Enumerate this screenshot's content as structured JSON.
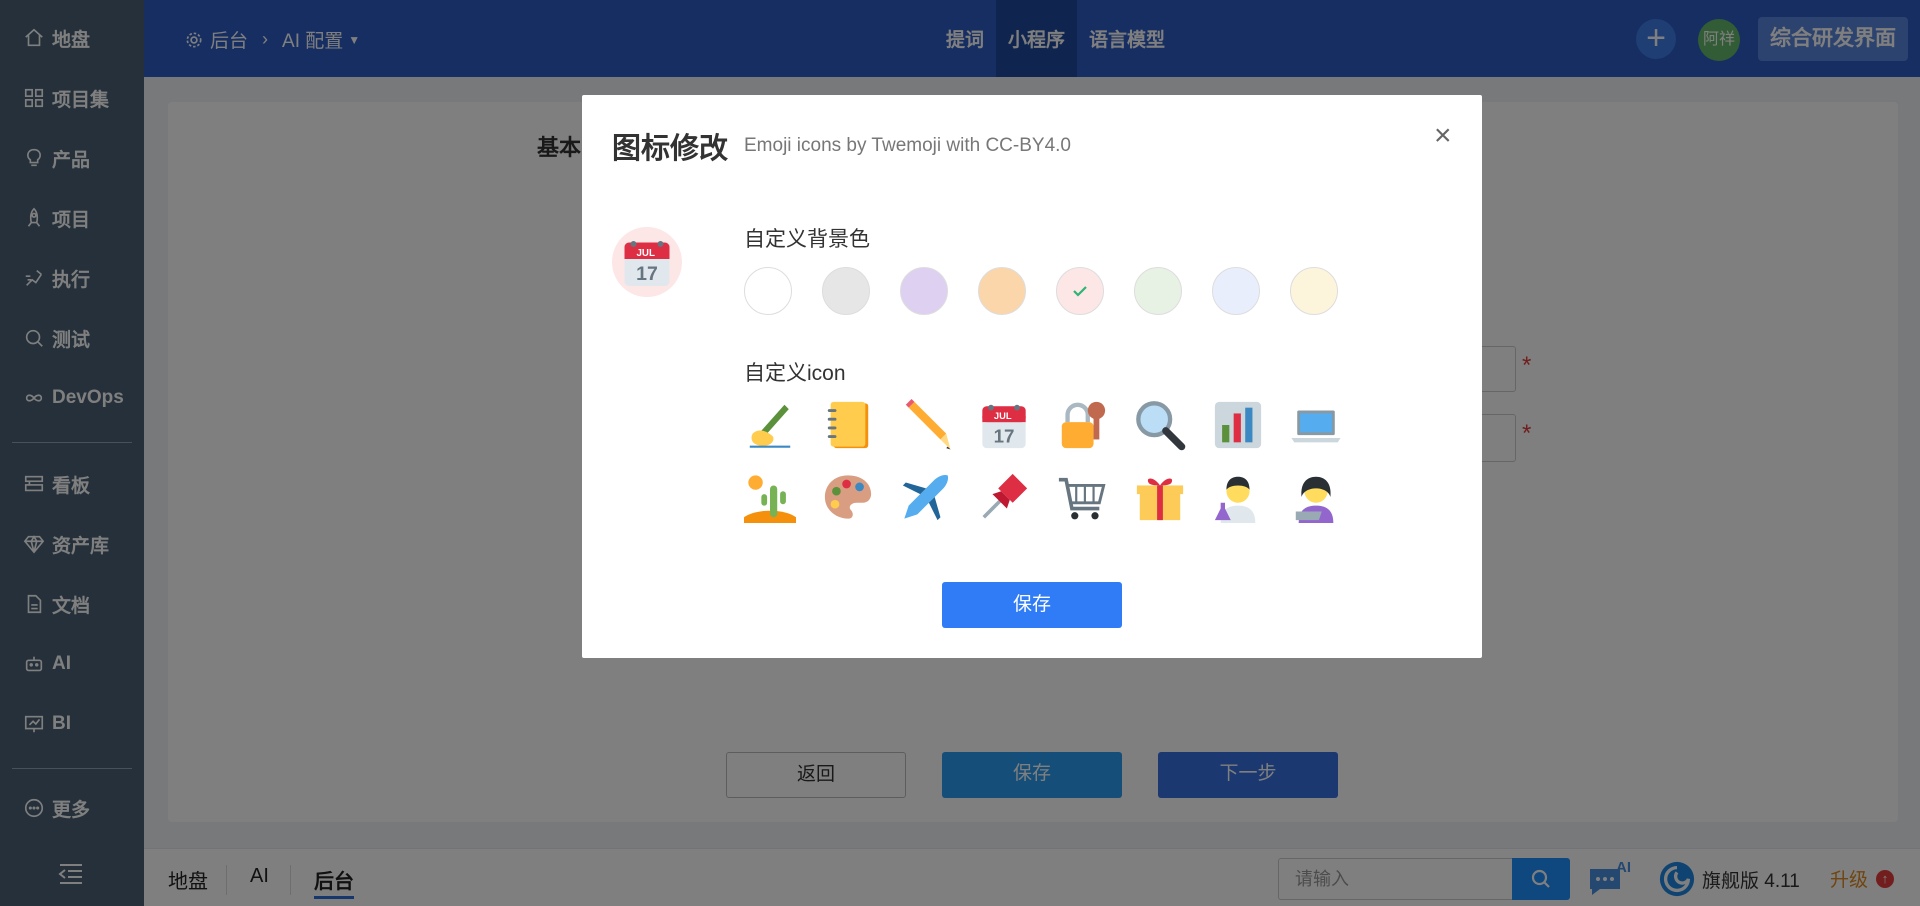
{
  "sidebar": {
    "items": [
      {
        "label": "地盘",
        "icon": "home-icon"
      },
      {
        "label": "项目集",
        "icon": "grid-icon"
      },
      {
        "label": "产品",
        "icon": "bulb-icon"
      },
      {
        "label": "项目",
        "icon": "rocket-icon"
      },
      {
        "label": "执行",
        "icon": "run-icon"
      },
      {
        "label": "测试",
        "icon": "test-icon"
      },
      {
        "label": "DevOps",
        "icon": "infinity-icon"
      },
      {
        "label": "看板",
        "icon": "kanban-icon"
      },
      {
        "label": "资产库",
        "icon": "diamond-icon"
      },
      {
        "label": "文档",
        "icon": "document-icon"
      },
      {
        "label": "AI",
        "icon": "robot-icon"
      },
      {
        "label": "BI",
        "icon": "chart-icon"
      },
      {
        "label": "更多",
        "icon": "more-icon"
      }
    ]
  },
  "header": {
    "breadcrumb": {
      "root": "后台",
      "current": "AI 配置"
    },
    "tabs": [
      {
        "label": "提词"
      },
      {
        "label": "小程序"
      },
      {
        "label": "语言模型"
      }
    ],
    "avatar": "阿祥",
    "main_button": "综合研发界面"
  },
  "form": {
    "section_title": "基本",
    "back_label": "返回",
    "save_label": "保存",
    "next_label": "下一步"
  },
  "bottom": {
    "tabs": [
      {
        "label": "地盘"
      },
      {
        "label": "AI"
      },
      {
        "label": "后台"
      }
    ],
    "search_placeholder": "请输入",
    "ai_badge": "AI",
    "edition": "旗舰版 4.11",
    "upgrade": "升级"
  },
  "modal": {
    "title": "图标修改",
    "subtitle": "Emoji icons by Twemoji with CC-BY4.0",
    "close": "×",
    "bg_label": "自定义背景色",
    "icon_label": "自定义icon",
    "save_label": "保存",
    "colors": [
      "#ffffff",
      "#e6e6e6",
      "#ded0f0",
      "#fbd6ab",
      "#fde6e6",
      "#e7f2e4",
      "#e8eefc",
      "#fdf4dc"
    ],
    "selected_color": "#fde6e6",
    "icons": [
      "writing-hand-icon",
      "notebook-icon",
      "pencil-icon",
      "calendar-icon",
      "lock-key-icon",
      "magnifier-icon",
      "bar-chart-icon",
      "laptop-icon",
      "desert-icon",
      "palette-icon",
      "airplane-icon",
      "pushpin-icon",
      "cart-icon",
      "gift-icon",
      "scientist-icon",
      "technologist-icon"
    ],
    "calendar_month": "JUL",
    "calendar_day": "17"
  }
}
